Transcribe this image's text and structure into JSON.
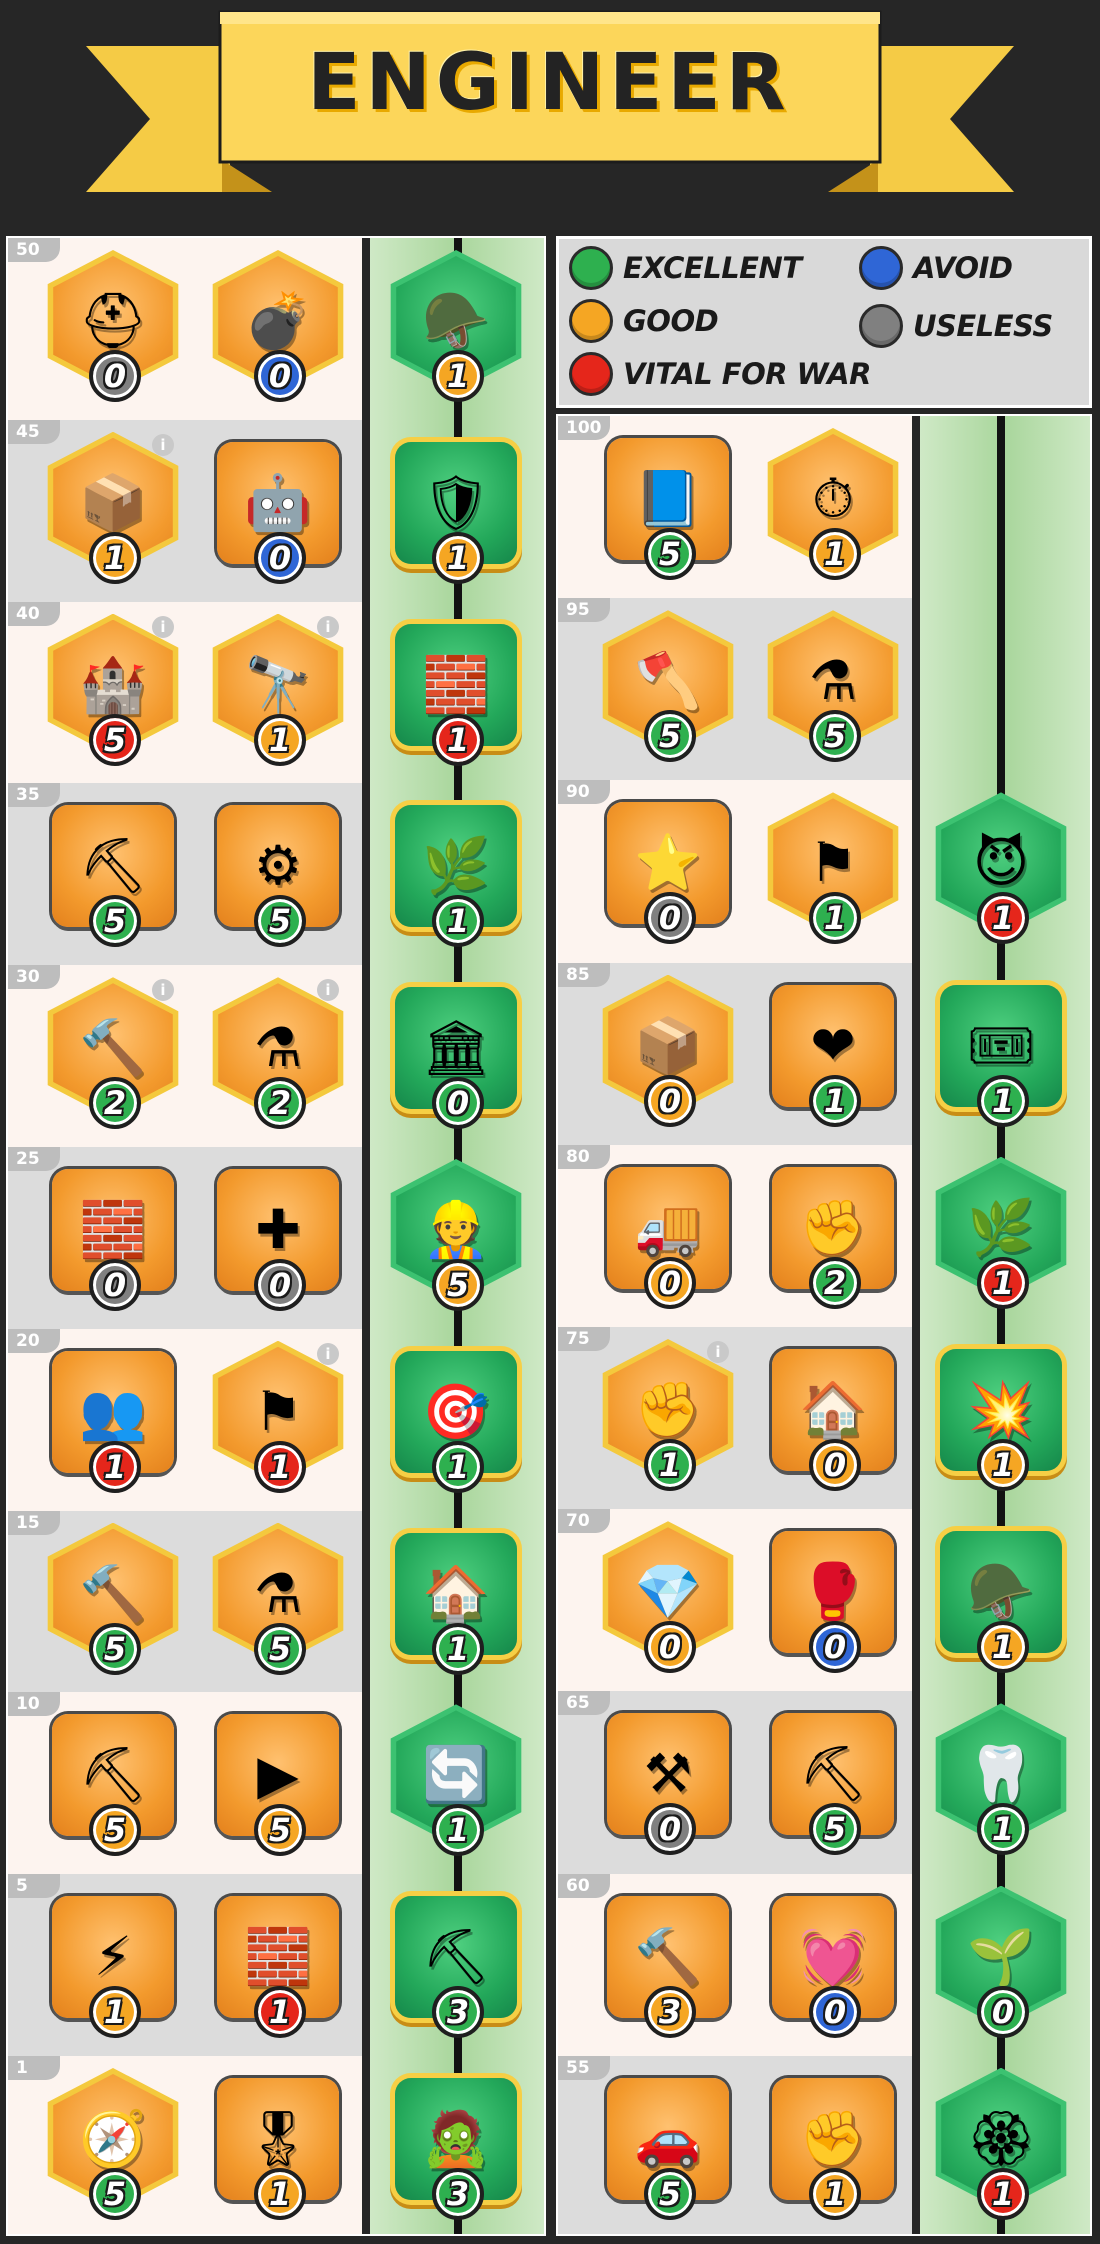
{
  "title": "ENGINEER",
  "colors": {
    "excellent": "#2eb04f",
    "good": "#f5a623",
    "vital": "#e5261b",
    "avoid": "#2f66d6",
    "useless": "#808080"
  },
  "legend": [
    {
      "label": "EXCELLENT",
      "color": "excellent"
    },
    {
      "label": "AVOID",
      "color": "avoid"
    },
    {
      "label": "GOOD",
      "color": "good"
    },
    {
      "label": "USELESS",
      "color": "useless"
    },
    {
      "label": "VITAL FOR WAR",
      "color": "vital"
    }
  ],
  "left_panel": [
    {
      "level": "50",
      "tiles": [
        {
          "icon": "helmet-plus-icon",
          "glyph": "⛑",
          "value": "0",
          "rating": "useless",
          "shape": "hex",
          "bg": "orange"
        },
        {
          "icon": "landmine-icon",
          "glyph": "💣",
          "value": "0",
          "rating": "avoid",
          "shape": "hex",
          "bg": "orange"
        },
        {
          "icon": "golden-helmet-plus-icon",
          "glyph": "🪖",
          "value": "1",
          "rating": "good",
          "shape": "hex",
          "bg": "green"
        }
      ]
    },
    {
      "level": "45",
      "tiles": [
        {
          "icon": "supply-crate-up-icon",
          "glyph": "📦",
          "value": "1",
          "rating": "good",
          "shape": "hex",
          "bg": "orange",
          "info": true
        },
        {
          "icon": "robot-shield-icon",
          "glyph": "🤖",
          "value": "0",
          "rating": "avoid",
          "shape": "sq",
          "bg": "orange"
        },
        {
          "icon": "helmet-shield-arrows-icon",
          "glyph": "🛡",
          "value": "1",
          "rating": "good",
          "shape": "sq",
          "bg": "green"
        }
      ]
    },
    {
      "level": "40",
      "tiles": [
        {
          "icon": "fortress-share-icon",
          "glyph": "🏰",
          "value": "5",
          "rating": "vital",
          "shape": "hex",
          "bg": "orange",
          "info": true
        },
        {
          "icon": "dome-share-icon",
          "glyph": "🔭",
          "value": "1",
          "rating": "good",
          "shape": "hex",
          "bg": "orange",
          "info": true
        },
        {
          "icon": "wall-helmet-icon",
          "glyph": "🧱",
          "value": "1",
          "rating": "vital",
          "shape": "sq",
          "bg": "green"
        }
      ]
    },
    {
      "level": "35",
      "tiles": [
        {
          "icon": "gold-helmet-icon",
          "glyph": "⛏",
          "value": "5",
          "rating": "excellent",
          "shape": "sq",
          "bg": "orange"
        },
        {
          "icon": "gear-icon",
          "glyph": "⚙",
          "value": "5",
          "rating": "excellent",
          "shape": "sq",
          "bg": "orange"
        },
        {
          "icon": "leaf-up-icon",
          "glyph": "🌿",
          "value": "1",
          "rating": "excellent",
          "shape": "sq",
          "bg": "green"
        }
      ]
    },
    {
      "level": "30",
      "tiles": [
        {
          "icon": "hammer-share-icon",
          "glyph": "🔨",
          "value": "2",
          "rating": "excellent",
          "shape": "hex",
          "bg": "orange",
          "info": true
        },
        {
          "icon": "flasks-share-icon",
          "glyph": "⚗",
          "value": "2",
          "rating": "excellent",
          "shape": "hex",
          "bg": "orange",
          "info": true
        },
        {
          "icon": "building-up-icon",
          "glyph": "🏛",
          "value": "0",
          "rating": "excellent",
          "shape": "sq",
          "bg": "green"
        }
      ]
    },
    {
      "level": "25",
      "tiles": [
        {
          "icon": "wall-exp-icon",
          "glyph": "🧱",
          "value": "0",
          "rating": "useless",
          "shape": "sq",
          "bg": "orange"
        },
        {
          "icon": "shield-cross-icon",
          "glyph": "✚",
          "value": "0",
          "rating": "useless",
          "shape": "sq",
          "bg": "orange"
        },
        {
          "icon": "engineer-portrait-icon",
          "glyph": "👷",
          "value": "5",
          "rating": "good",
          "shape": "hex",
          "bg": "green"
        }
      ]
    },
    {
      "level": "20",
      "tiles": [
        {
          "icon": "soldiers-icon",
          "glyph": "👥",
          "value": "1",
          "rating": "vital",
          "shape": "sq",
          "bg": "orange"
        },
        {
          "icon": "blue-flag-icon",
          "glyph": "⚑",
          "value": "1",
          "rating": "vital",
          "shape": "hex",
          "bg": "orange",
          "info": true
        },
        {
          "icon": "target-badge-up-icon",
          "glyph": "🎯",
          "value": "1",
          "rating": "excellent",
          "shape": "sq",
          "bg": "green"
        }
      ]
    },
    {
      "level": "15",
      "tiles": [
        {
          "icon": "hammer-timer-icon",
          "glyph": "🔨",
          "value": "5",
          "rating": "excellent",
          "shape": "hex",
          "bg": "orange"
        },
        {
          "icon": "flasks-timer-icon",
          "glyph": "⚗",
          "value": "5",
          "rating": "excellent",
          "shape": "hex",
          "bg": "orange"
        },
        {
          "icon": "free-build-icon",
          "glyph": "🏠",
          "value": "1",
          "rating": "excellent",
          "shape": "sq",
          "bg": "green"
        }
      ]
    },
    {
      "level": "10",
      "tiles": [
        {
          "icon": "axe-up-icon",
          "glyph": "⛏",
          "value": "5",
          "rating": "good",
          "shape": "sq",
          "bg": "orange"
        },
        {
          "icon": "play-gem-icon",
          "glyph": "▶",
          "value": "5",
          "rating": "good",
          "shape": "sq",
          "bg": "orange"
        },
        {
          "icon": "refresh-x2-icon",
          "glyph": "🔄",
          "value": "1",
          "rating": "excellent",
          "shape": "hex",
          "bg": "green"
        }
      ]
    },
    {
      "level": "5",
      "tiles": [
        {
          "icon": "lightning-50-icon",
          "glyph": "⚡",
          "value": "1",
          "rating": "good",
          "shape": "sq",
          "bg": "orange"
        },
        {
          "icon": "wall-burst-icon",
          "glyph": "🧱",
          "value": "1",
          "rating": "vital",
          "shape": "sq",
          "bg": "orange"
        },
        {
          "icon": "pickaxe-exp-icon",
          "glyph": "⛏",
          "value": "3",
          "rating": "excellent",
          "shape": "sq",
          "bg": "green"
        }
      ]
    },
    {
      "level": "1",
      "tiles": [
        {
          "icon": "compass-icon",
          "glyph": "🧭",
          "value": "5",
          "rating": "excellent",
          "shape": "hex",
          "bg": "orange"
        },
        {
          "icon": "badge-up-icon",
          "glyph": "🎖",
          "value": "1",
          "rating": "good",
          "shape": "sq",
          "bg": "orange"
        },
        {
          "icon": "zombie-exp-icon",
          "glyph": "🧟",
          "value": "3",
          "rating": "excellent",
          "shape": "sq",
          "bg": "green"
        }
      ]
    }
  ],
  "right_panel": [
    {
      "level": "100",
      "tiles": [
        {
          "icon": "blue-book-refresh-icon",
          "glyph": "📘",
          "value": "5",
          "rating": "excellent",
          "shape": "sq",
          "bg": "orange"
        },
        {
          "icon": "time-bomb-icon",
          "glyph": "⏱",
          "value": "1",
          "rating": "good",
          "shape": "hex",
          "bg": "orange"
        }
      ]
    },
    {
      "level": "95",
      "tiles": [
        {
          "icon": "axe-share-ii-icon",
          "glyph": "🪓",
          "value": "5",
          "rating": "excellent",
          "shape": "hex",
          "bg": "orange"
        },
        {
          "icon": "flasks-share-ii-icon",
          "glyph": "⚗",
          "value": "5",
          "rating": "excellent",
          "shape": "hex",
          "bg": "orange"
        }
      ]
    },
    {
      "level": "90",
      "tiles": [
        {
          "icon": "star-badge-up-icon",
          "glyph": "⭐",
          "value": "0",
          "rating": "useless",
          "shape": "sq",
          "bg": "orange"
        },
        {
          "icon": "flag-up-icon",
          "glyph": "⚑",
          "value": "1",
          "rating": "excellent",
          "shape": "hex",
          "bg": "orange"
        },
        {
          "icon": "demon-skull-icon",
          "glyph": "😈",
          "value": "1",
          "rating": "vital",
          "shape": "hex",
          "bg": "green"
        }
      ]
    },
    {
      "level": "85",
      "tiles": [
        {
          "icon": "crate-forward-icon",
          "glyph": "📦",
          "value": "0",
          "rating": "good",
          "shape": "hex",
          "bg": "orange"
        },
        {
          "icon": "heart-plus-icon",
          "glyph": "❤",
          "value": "1",
          "rating": "excellent",
          "shape": "sq",
          "bg": "orange"
        },
        {
          "icon": "discount-ticket-icon",
          "glyph": "🎟",
          "value": "1",
          "rating": "excellent",
          "shape": "sq",
          "bg": "green"
        }
      ]
    },
    {
      "level": "80",
      "tiles": [
        {
          "icon": "truck-up-icon",
          "glyph": "🚚",
          "value": "0",
          "rating": "good",
          "shape": "sq",
          "bg": "orange"
        },
        {
          "icon": "fist-plus-icon",
          "glyph": "✊",
          "value": "2",
          "rating": "excellent",
          "shape": "sq",
          "bg": "orange"
        },
        {
          "icon": "claw-icon",
          "glyph": "🌿",
          "value": "1",
          "rating": "vital",
          "shape": "hex",
          "bg": "green"
        }
      ]
    },
    {
      "level": "75",
      "tiles": [
        {
          "icon": "fist-share-icon",
          "glyph": "✊",
          "value": "1",
          "rating": "excellent",
          "shape": "hex",
          "bg": "orange",
          "info": true
        },
        {
          "icon": "free-refresh-icon",
          "glyph": "🏠",
          "value": "0",
          "rating": "good",
          "shape": "sq",
          "bg": "orange"
        },
        {
          "icon": "helmet-burst-icon",
          "glyph": "💥",
          "value": "1",
          "rating": "good",
          "shape": "sq",
          "bg": "green"
        }
      ]
    },
    {
      "level": "70",
      "tiles": [
        {
          "icon": "crystal-plus-icon",
          "glyph": "💎",
          "value": "0",
          "rating": "good",
          "shape": "hex",
          "bg": "orange"
        },
        {
          "icon": "boxing-glove-icon",
          "glyph": "🥊",
          "value": "0",
          "rating": "avoid",
          "shape": "sq",
          "bg": "orange"
        },
        {
          "icon": "golden-helmet-refresh-icon",
          "glyph": "🪖",
          "value": "1",
          "rating": "good",
          "shape": "sq",
          "bg": "green"
        }
      ]
    },
    {
      "level": "65",
      "tiles": [
        {
          "icon": "anvil-discount-icon",
          "glyph": "⚒",
          "value": "0",
          "rating": "useless",
          "shape": "sq",
          "bg": "orange"
        },
        {
          "icon": "axe-up-icon",
          "glyph": "⛏",
          "value": "5",
          "rating": "excellent",
          "shape": "sq",
          "bg": "orange"
        },
        {
          "icon": "fangs-icon",
          "glyph": "🦷",
          "value": "1",
          "rating": "excellent",
          "shape": "hex",
          "bg": "green"
        }
      ]
    },
    {
      "level": "60",
      "tiles": [
        {
          "icon": "hammer-up-icon",
          "glyph": "🔨",
          "value": "3",
          "rating": "good",
          "shape": "sq",
          "bg": "orange"
        },
        {
          "icon": "heartbeat-up-icon",
          "glyph": "💓",
          "value": "0",
          "rating": "avoid",
          "shape": "sq",
          "bg": "orange"
        },
        {
          "icon": "plant-icon",
          "glyph": "🌱",
          "value": "0",
          "rating": "excellent",
          "shape": "hex",
          "bg": "green"
        }
      ]
    },
    {
      "level": "55",
      "tiles": [
        {
          "icon": "car-x2-icon",
          "glyph": "🚗",
          "value": "5",
          "rating": "excellent",
          "shape": "sq",
          "bg": "orange"
        },
        {
          "icon": "fist-up-icon",
          "glyph": "✊",
          "value": "1",
          "rating": "good",
          "shape": "sq",
          "bg": "orange"
        },
        {
          "icon": "golden-ring-icon",
          "glyph": "🏵",
          "value": "1",
          "rating": "vital",
          "shape": "hex",
          "bg": "green"
        }
      ]
    }
  ]
}
